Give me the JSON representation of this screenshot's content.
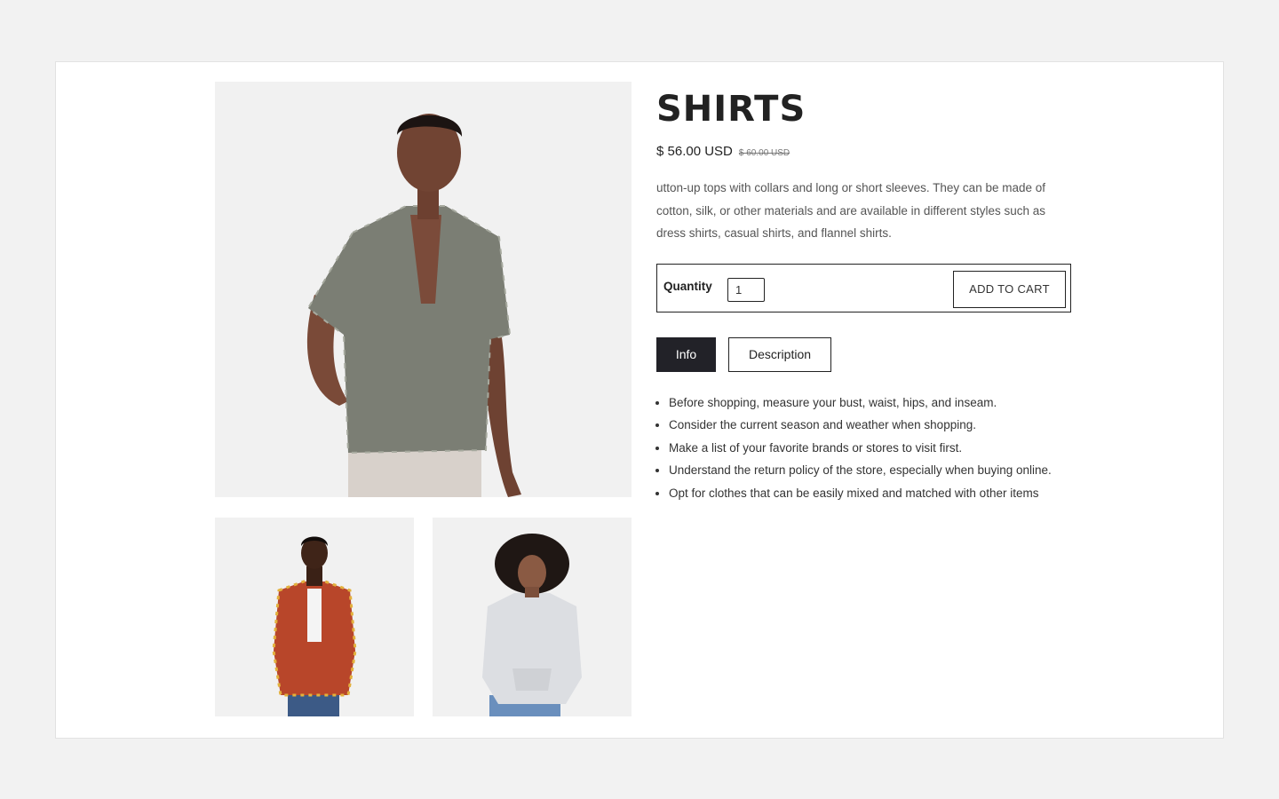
{
  "product": {
    "title": "SHIRTS",
    "price": "$ 56.00 USD",
    "compare_price": "$ 60.00 USD",
    "description": "utton-up tops with collars and long or short sleeves. They can be made of cotton, silk, or other materials and are available in different styles such as dress shirts, casual shirts, and flannel shirts."
  },
  "cart": {
    "quantity_label": "Quantity",
    "quantity_value": "1",
    "add_to_cart_label": "ADD TO CART"
  },
  "tabs": [
    {
      "label": "Info",
      "active": true
    },
    {
      "label": "Description",
      "active": false
    }
  ],
  "info_bullets": [
    "Before shopping, measure your bust, waist, hips, and inseam.",
    "Consider the current season and weather when shopping.",
    "Make a list of your favorite brands or stores to visit first.",
    "Understand the return policy of the store, especially when buying online.",
    "Opt for clothes that can be easily mixed and matched with other items"
  ],
  "colors": {
    "page_bg": "#f2f2f2",
    "card_bg": "#ffffff",
    "image_bg": "#f1f1f1",
    "accent_dark": "#222228",
    "text": "#222222"
  }
}
